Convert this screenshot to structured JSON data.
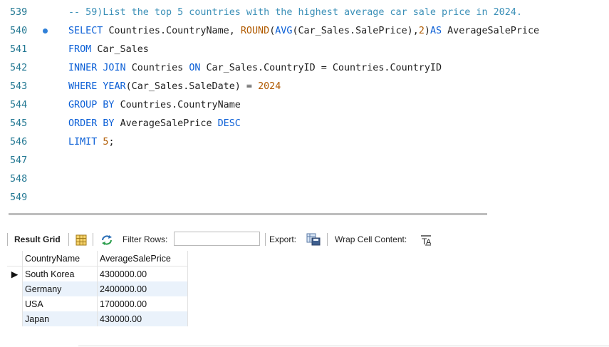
{
  "editor": {
    "lines": [
      {
        "n": "539",
        "tokens": [
          {
            "t": "-- 59)List the top 5 countries with the highest average car sale price in 2024.",
            "c": "cm"
          }
        ]
      },
      {
        "n": "540",
        "marker": true,
        "tokens": [
          {
            "t": "SELECT ",
            "c": "kw"
          },
          {
            "t": "Countries.CountryName, ",
            "c": "pl"
          },
          {
            "t": "ROUND",
            "c": "fn"
          },
          {
            "t": "(",
            "c": "pl"
          },
          {
            "t": "AVG",
            "c": "kw"
          },
          {
            "t": "(Car_Sales.SalePrice),",
            "c": "pl"
          },
          {
            "t": "2",
            "c": "num"
          },
          {
            "t": ")",
            "c": "pl"
          },
          {
            "t": "AS ",
            "c": "kw"
          },
          {
            "t": "AverageSalePrice",
            "c": "pl"
          }
        ]
      },
      {
        "n": "541",
        "tokens": [
          {
            "t": "FROM ",
            "c": "kw"
          },
          {
            "t": "Car_Sales",
            "c": "pl"
          }
        ]
      },
      {
        "n": "542",
        "tokens": [
          {
            "t": "INNER JOIN ",
            "c": "kw"
          },
          {
            "t": "Countries ",
            "c": "pl"
          },
          {
            "t": "ON ",
            "c": "kw"
          },
          {
            "t": "Car_Sales.CountryID = Countries.CountryID",
            "c": "pl"
          }
        ]
      },
      {
        "n": "543",
        "tokens": [
          {
            "t": "WHERE ",
            "c": "kw"
          },
          {
            "t": "YEAR",
            "c": "kw"
          },
          {
            "t": "(Car_Sales.SaleDate) = ",
            "c": "pl"
          },
          {
            "t": "2024",
            "c": "num"
          }
        ]
      },
      {
        "n": "544",
        "tokens": [
          {
            "t": "GROUP BY ",
            "c": "kw"
          },
          {
            "t": "Countries.CountryName",
            "c": "pl"
          }
        ]
      },
      {
        "n": "545",
        "tokens": [
          {
            "t": "ORDER BY ",
            "c": "kw"
          },
          {
            "t": "AverageSalePrice ",
            "c": "pl"
          },
          {
            "t": "DESC",
            "c": "kw"
          }
        ]
      },
      {
        "n": "546",
        "tokens": [
          {
            "t": "LIMIT ",
            "c": "kw"
          },
          {
            "t": "5",
            "c": "num"
          },
          {
            "t": ";",
            "c": "pl"
          }
        ]
      },
      {
        "n": "547",
        "tokens": []
      },
      {
        "n": "548",
        "tokens": []
      },
      {
        "n": "549",
        "tokens": []
      }
    ]
  },
  "toolbar": {
    "result_grid_label": "Result Grid",
    "filter_rows_label": "Filter Rows:",
    "filter_value": "",
    "export_label": "Export:",
    "wrap_label": "Wrap Cell Content:",
    "grid_icon": "grid-icon",
    "refresh_icon": "refresh-icon",
    "export_icon": "export-icon",
    "wrap_icon": "wrap-icon"
  },
  "grid": {
    "columns": [
      "CountryName",
      "AverageSalePrice"
    ],
    "rows": [
      [
        "South Korea",
        "4300000.00"
      ],
      [
        "Germany",
        "2400000.00"
      ],
      [
        "USA",
        "1700000.00"
      ],
      [
        "Japan",
        "430000.00"
      ]
    ],
    "current_row_marker": "▶"
  }
}
